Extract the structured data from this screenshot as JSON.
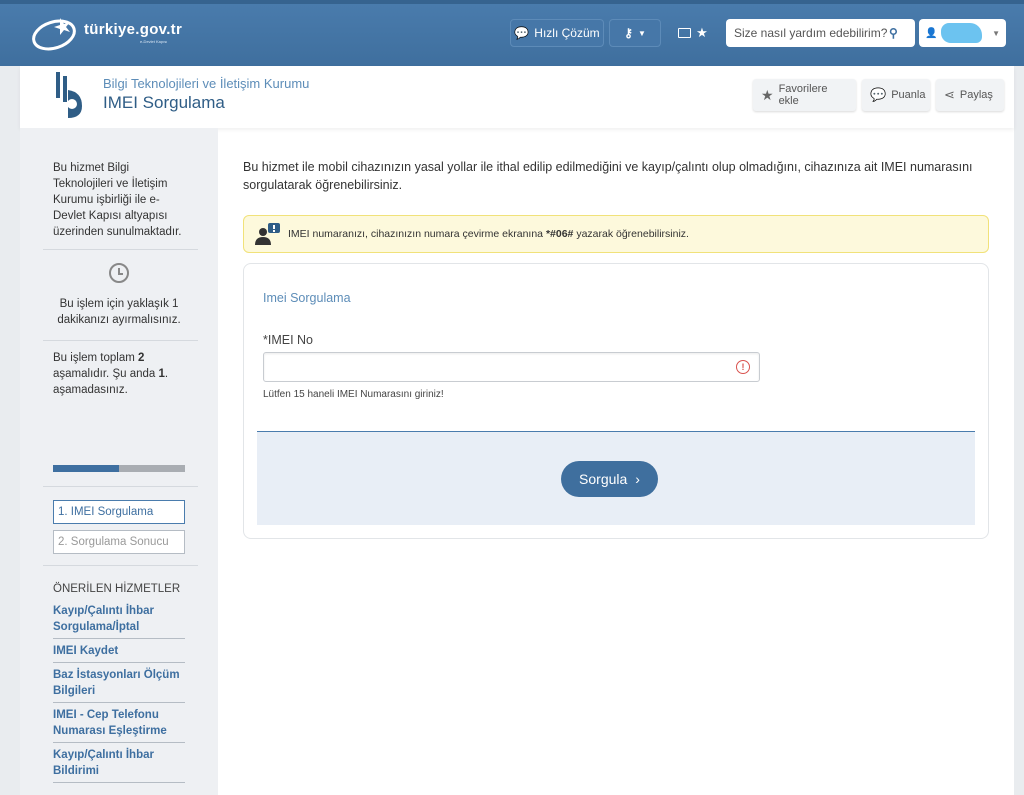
{
  "header": {
    "logo_text": "türkiye.gov.tr",
    "logo_tagline": "e-Devlet Kapısı",
    "quick_solution_label": "Hızlı Çözüm",
    "search_placeholder": "Size nasıl yardım edebilirim?"
  },
  "service": {
    "institution": "Bilgi Teknolojileri ve İletişim Kurumu",
    "title": "IMEI Sorgulama",
    "actions": {
      "favorite": "Favorilere ekle",
      "rate": "Puanla",
      "share": "Paylaş"
    }
  },
  "sidebar": {
    "provider_text": "Bu hizmet Bilgi Teknolojileri ve İletişim Kurumu işbirliği ile e-Devlet Kapısı altyapısı üzerinden sunulmaktadır.",
    "time_text": "Bu işlem için yaklaşık 1 dakikanızı ayırmalısınız.",
    "steps_text_1": "Bu işlem toplam ",
    "steps_total": "2",
    "steps_text_2": " aşamalıdır. Şu anda ",
    "steps_current": "1",
    "steps_text_3": ". aşamadasınız.",
    "progress_fraction": 0.5,
    "steps": [
      {
        "label": "1. IMEI Sorgulama"
      },
      {
        "label": "2. Sorgulama Sonucu"
      }
    ],
    "recommended_title": "ÖNERİLEN HİZMETLER",
    "recommended": [
      {
        "label": "Kayıp/Çalıntı İhbar Sorgulama/İptal"
      },
      {
        "label": "IMEI Kaydet"
      },
      {
        "label": "Baz İstasyonları Ölçüm Bilgileri"
      },
      {
        "label": "IMEI - Cep Telefonu Numarası Eşleştirme"
      },
      {
        "label": "Kayıp/Çalıntı İhbar Bildirimi"
      }
    ]
  },
  "main": {
    "intro": "Bu hizmet ile mobil cihazınızın yasal yollar ile ithal edilip edilmediğini ve kayıp/çalıntı olup olmadığını, cihazınıza ait IMEI numarasını sorgulatarak öğrenebilirsiniz.",
    "info_text_1": "IMEI numaranızı, cihazınızın numara çevirme ekranına ",
    "info_code": "*#06#",
    "info_text_2": " yazarak öğrenebilirsiniz.",
    "form_title": "Imei Sorgulama",
    "field_label": "*IMEI No",
    "field_value": "",
    "field_hint": "Lütfen 15 haneli IMEI Numarasını giriniz!",
    "submit_label": "Sorgula"
  },
  "colors": {
    "header_bg": "#4a7cad",
    "accent": "#3e6fa0",
    "info_bg": "#fdf9dc",
    "error": "#d9534f"
  }
}
